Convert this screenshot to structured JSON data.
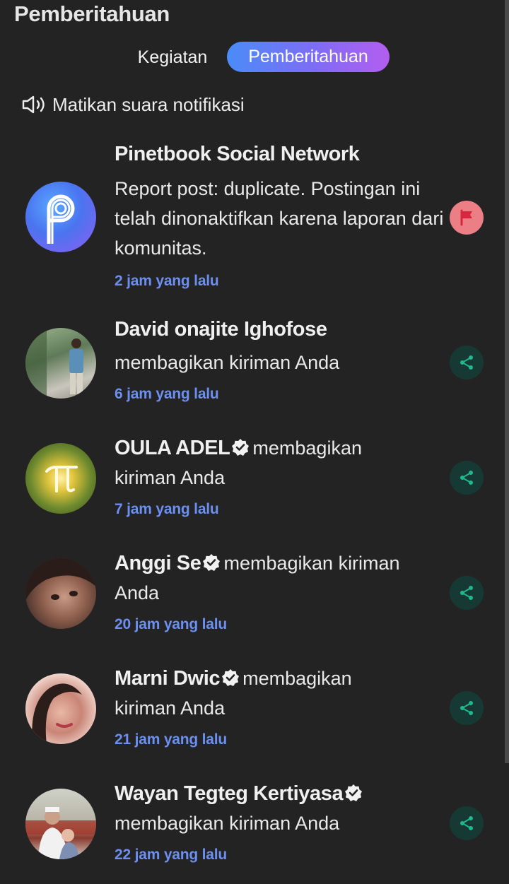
{
  "header": {
    "title": "Pemberitahuan"
  },
  "tabs": [
    {
      "label": "Kegiatan",
      "active": false
    },
    {
      "label": "Pemberitahuan",
      "active": true
    }
  ],
  "mute": {
    "label": "Matikan suara notifikasi",
    "icon": "speaker-icon"
  },
  "colors": {
    "background": "#232323",
    "accent_gradient": [
      "#4a8cf7",
      "#b35ef0"
    ],
    "time_text": "#6c8ff2",
    "share_bg": "#163a33",
    "share_icon": "#1fb88f",
    "flag_bg": "#ec7f86",
    "flag_icon": "#d7263d"
  },
  "notifications": [
    {
      "name": "Pinetbook Social Network",
      "verified": false,
      "message": "Report post: duplicate. Postingan ini telah dinonaktifkan karena laporan dari komunitas.",
      "time": "2 jam yang lalu",
      "action_icon": "flag-icon",
      "avatar": "pinetbook-logo"
    },
    {
      "name": "David onajite Ighofose",
      "verified": false,
      "message": "membagikan kiriman Anda",
      "time": "6 jam yang lalu",
      "action_icon": "share-icon",
      "avatar": "photo"
    },
    {
      "name": "OULA ADEL",
      "verified": true,
      "message_a": "membagikan",
      "message_b": "kiriman Anda",
      "time": "7 jam yang lalu",
      "action_icon": "share-icon",
      "avatar": "pi-symbol"
    },
    {
      "name": "Anggi Se",
      "verified": true,
      "message_a": "membagikan kiriman",
      "message_b": "Anda",
      "time": "20 jam yang lalu",
      "action_icon": "share-icon",
      "avatar": "photo"
    },
    {
      "name": "Marni Dwic",
      "verified": true,
      "message_a": "membagikan",
      "message_b": "kiriman Anda",
      "time": "21 jam yang lalu",
      "action_icon": "share-icon",
      "avatar": "photo"
    },
    {
      "name": "Wayan Tegteg Kertiyasa",
      "verified": true,
      "message": "membagikan kiriman Anda",
      "time": "22 jam yang lalu",
      "action_icon": "share-icon",
      "avatar": "photo"
    }
  ]
}
